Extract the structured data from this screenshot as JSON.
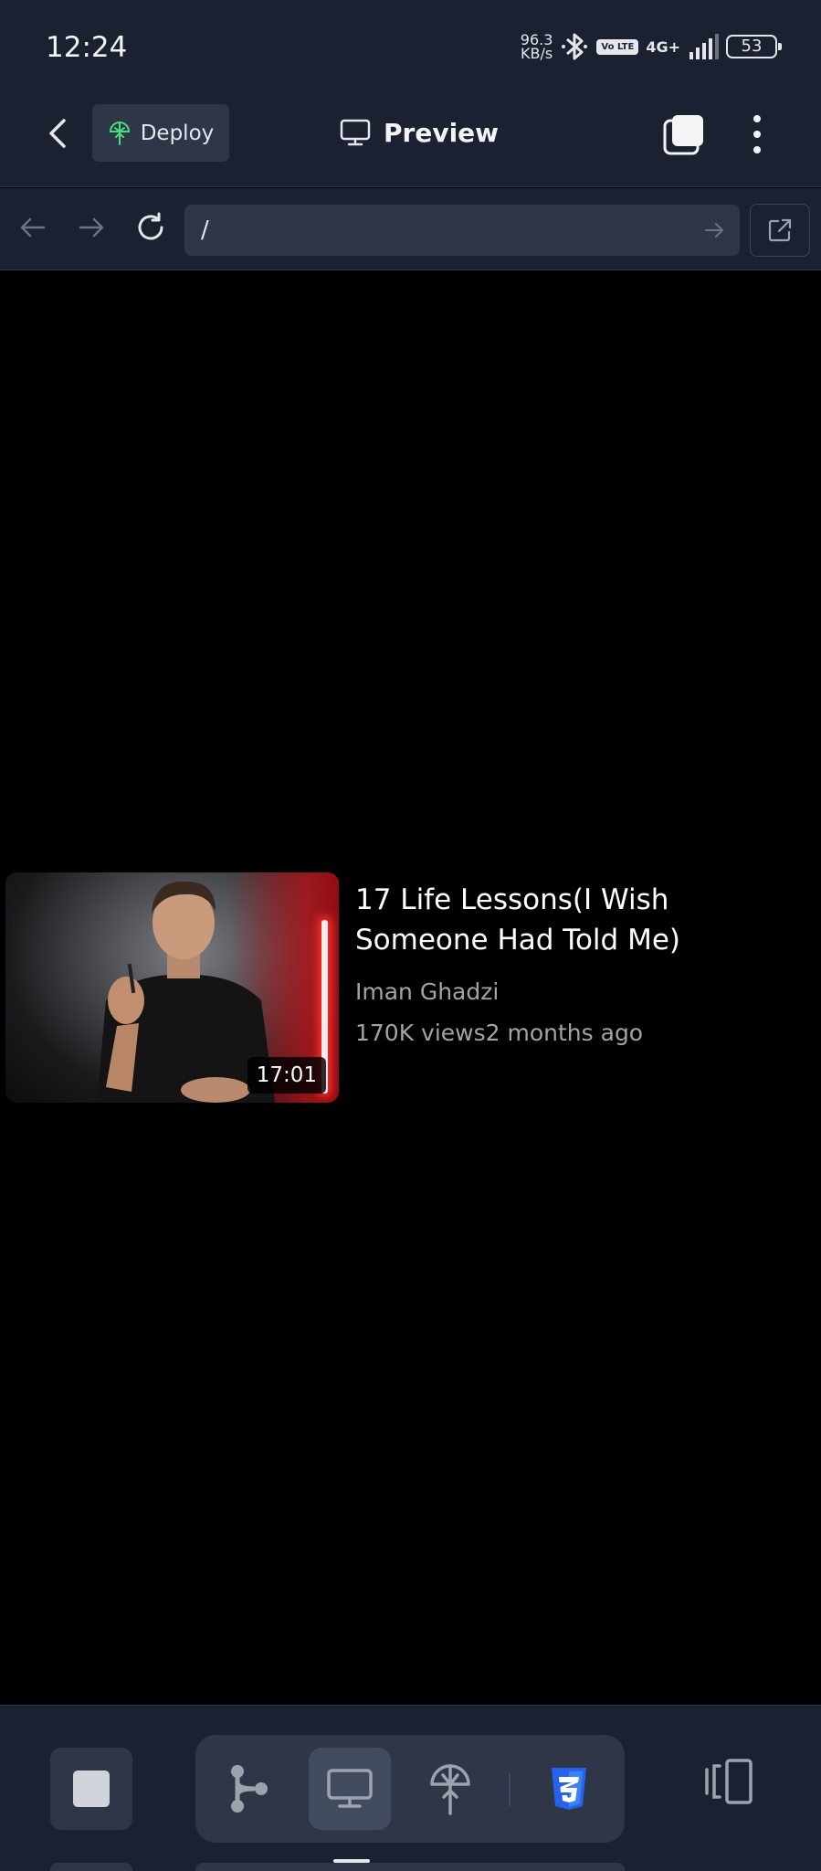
{
  "status_bar": {
    "time": "12:24",
    "net_speed_value": "96.3",
    "net_speed_unit": "KB/s",
    "volte": "Vo LTE",
    "network": "4G+",
    "battery": "53"
  },
  "app_bar": {
    "deploy_label": "Deploy",
    "title": "Preview"
  },
  "url_bar": {
    "url": "/"
  },
  "video": {
    "title": "17 Life Lessons(I Wish Someone Had Told Me)",
    "channel": "Iman Ghadzi",
    "views": "170K views",
    "age": "2 months ago",
    "duration": "17:01"
  },
  "colors": {
    "chrome_bg": "#1b2131",
    "control_bg": "#2e3647",
    "active_tool_bg": "#434c5e",
    "deploy_icon": "#4ade80",
    "css_icon": "#2563eb",
    "content_bg": "#000000",
    "muted_text": "#a3a3a3"
  },
  "icons": {
    "back": "chevron-left-icon",
    "deploy": "deploy-icon",
    "preview": "monitor-icon",
    "tabs": "tabs-icon",
    "more": "more-vertical-icon",
    "nav_back": "arrow-left-icon",
    "nav_forward": "arrow-right-icon",
    "reload": "reload-icon",
    "go": "arrow-right-icon",
    "external": "external-link-icon",
    "stop": "stop-icon",
    "tools": [
      "workflow-icon",
      "monitor-icon",
      "deploy-icon",
      "css3-icon"
    ],
    "device": "device-toggle-icon"
  }
}
